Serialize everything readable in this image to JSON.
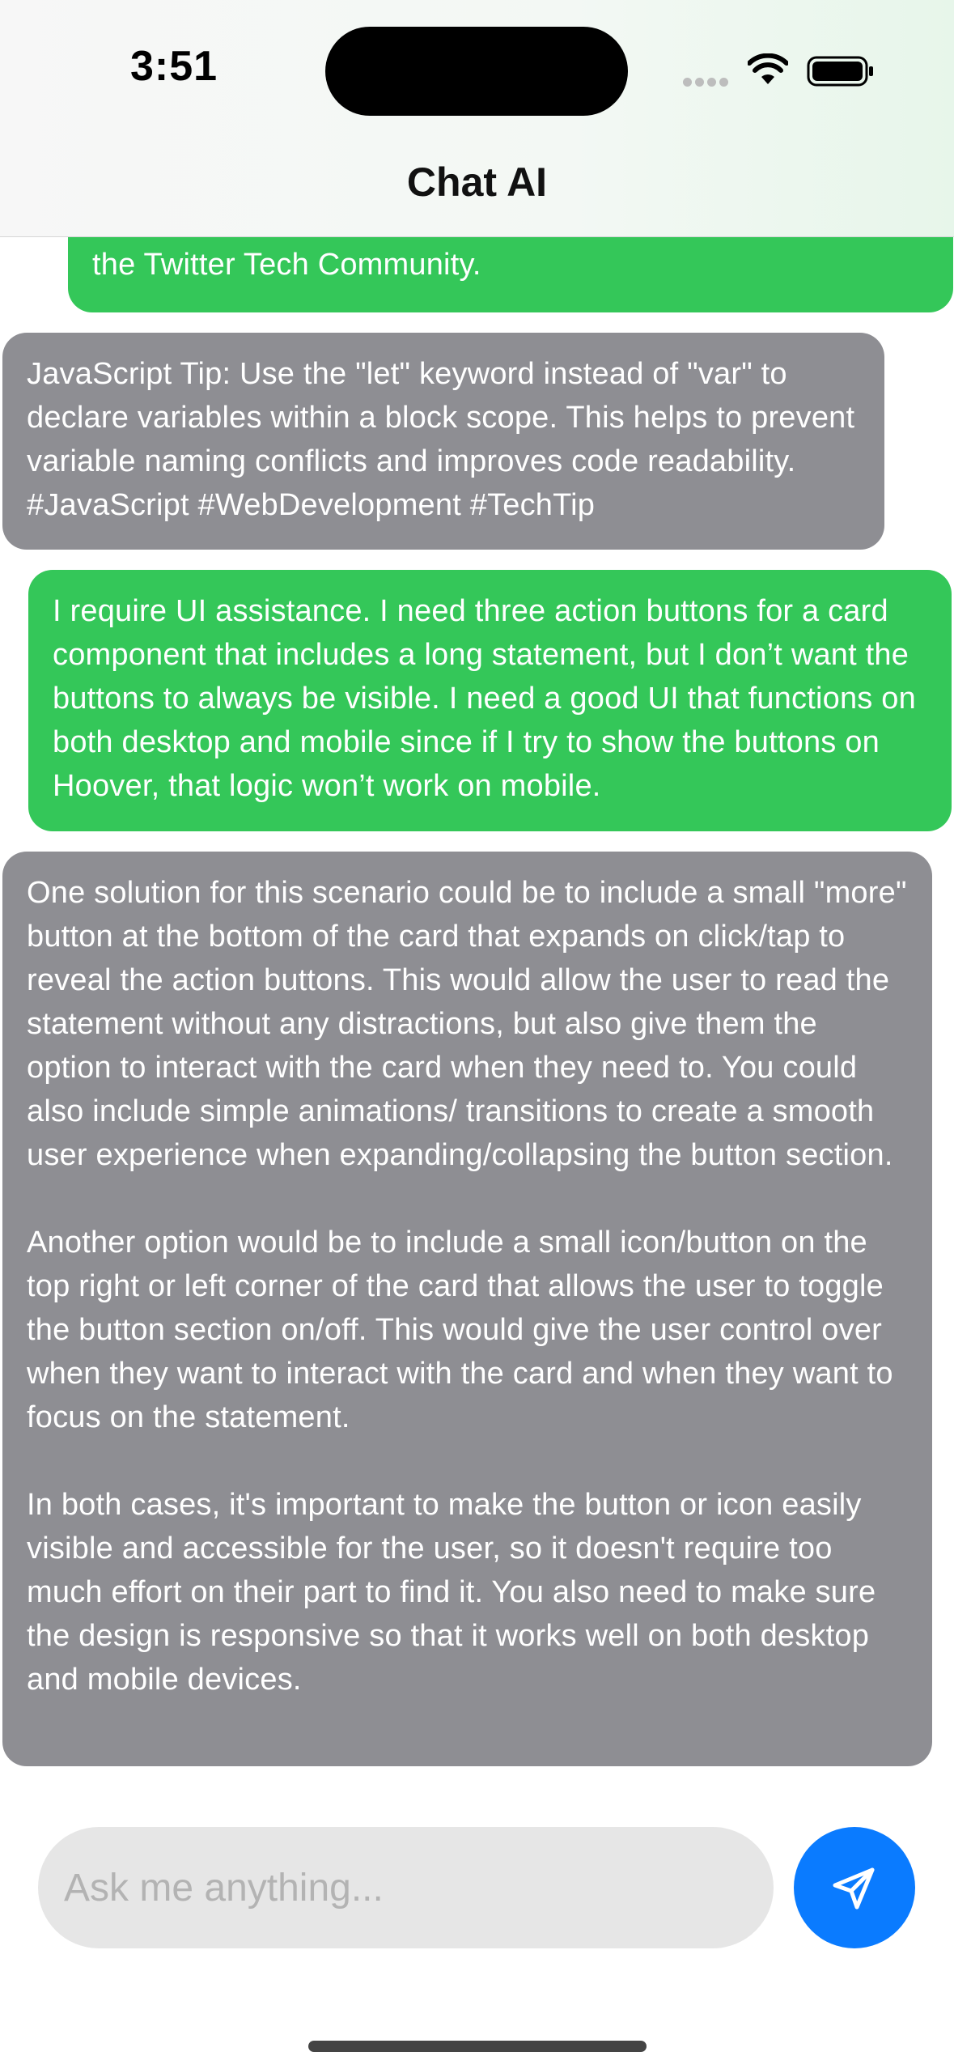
{
  "status_bar": {
    "time": "3:51"
  },
  "header": {
    "title": "Chat AI"
  },
  "messages": [
    {
      "role": "user",
      "text": "the Twitter Tech Community."
    },
    {
      "role": "assistant",
      "text": "JavaScript Tip: Use the \"let\" keyword instead of \"var\" to declare variables within a block scope. This helps to prevent variable naming conflicts and improves code readability. #JavaScript #WebDevelopment #TechTip"
    },
    {
      "role": "user",
      "text": "I require UI assistance. I need three action buttons for a card component that includes a long statement, but I don’t want the buttons to always be visible. I need a good UI that functions on both desktop and mobile since if I try to show the buttons on Hoover, that logic won’t work on mobile."
    },
    {
      "role": "assistant",
      "text": "One solution for this scenario could be to include a small \"more\" button at the bottom of the card that expands on click/tap to reveal the action buttons. This would allow the user to read the statement without any distractions, but also give them the option to interact with the card when they need to. You could also include simple animations/ transitions to create a smooth user experience when expanding/collapsing the button section.\n\nAnother option would be to include a small icon/button on the top right or left corner of the card that allows the user to toggle the button section on/off. This would give the user control over when they want to interact with the card and when they want to focus on the statement.\n\nIn both cases, it's important to make the button or icon easily visible and accessible for the user, so it doesn't require too much effort on their part to find it. You also need to make sure the design is responsive so that it works well on both desktop and mobile devices."
    }
  ],
  "composer": {
    "placeholder": "Ask me anything...",
    "value": "",
    "send_icon": "paper-plane-icon"
  },
  "colors": {
    "user_bubble": "#34c759",
    "assistant_bubble": "#8e8e93",
    "send_button": "#0a7bff",
    "input_background": "#e6e6e6"
  }
}
